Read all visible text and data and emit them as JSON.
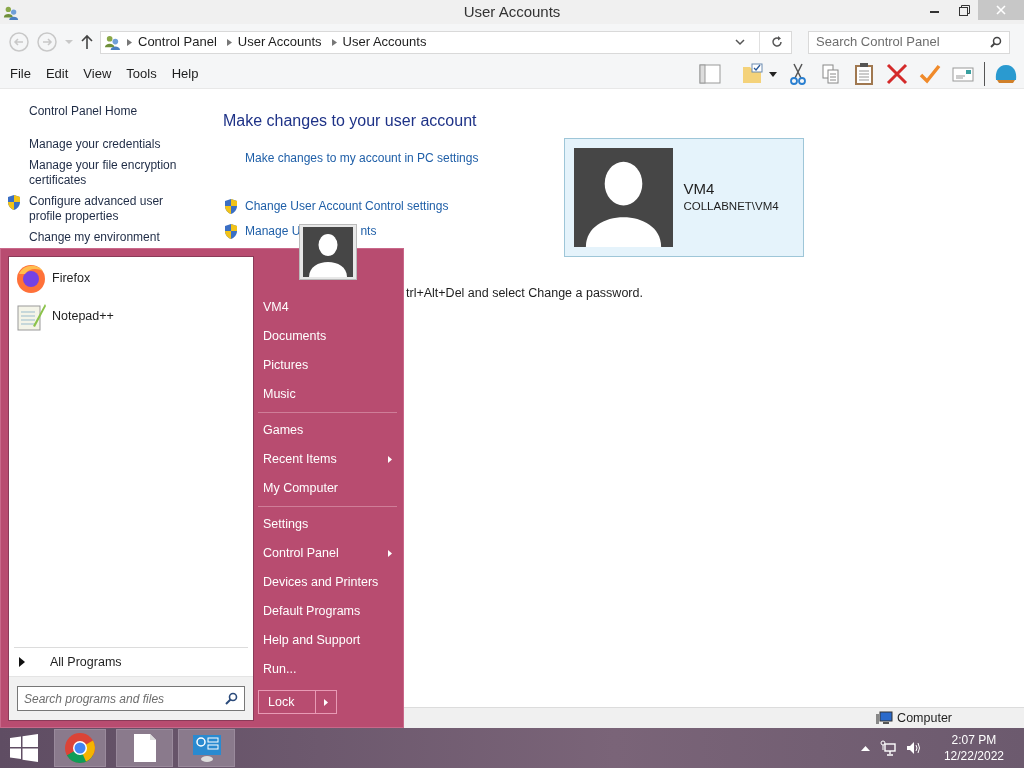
{
  "window": {
    "title": "User Accounts"
  },
  "address": {
    "breadcrumbs": [
      "Control Panel",
      "User Accounts",
      "User Accounts"
    ]
  },
  "search": {
    "placeholder": "Search Control Panel"
  },
  "menu": [
    "File",
    "Edit",
    "View",
    "Tools",
    "Help"
  ],
  "sidebar": {
    "items": [
      {
        "text": "Control Panel Home",
        "shield": false
      },
      {
        "text": "Manage your credentials",
        "shield": false
      },
      {
        "text": "Manage your file encryption certificates",
        "shield": false
      },
      {
        "text": "Configure advanced user profile properties",
        "shield": true
      },
      {
        "text": "Change my environment",
        "shield": false
      }
    ]
  },
  "main": {
    "heading": "Make changes to your user account",
    "links": [
      {
        "text": "Make changes to my account in PC settings",
        "shield": false
      },
      {
        "text": "Change User Account Control settings",
        "shield": true
      },
      {
        "text": "Manage U",
        "tail": "nts",
        "shield": true
      }
    ],
    "account": {
      "name": "VM4",
      "domain": "COLLABNET\\VM4"
    },
    "note": "trl+Alt+Del and select Change a password."
  },
  "start_menu": {
    "pinned": [
      {
        "name": "Firefox",
        "kind": "firefox"
      },
      {
        "name": "Notepad++",
        "kind": "notepad"
      }
    ],
    "all_programs": "All Programs",
    "search_placeholder": "Search programs and files",
    "groups": [
      [
        {
          "text": "VM4",
          "submenu": false
        },
        {
          "text": "Documents",
          "submenu": false
        },
        {
          "text": "Pictures",
          "submenu": false
        },
        {
          "text": "Music",
          "submenu": false
        }
      ],
      [
        {
          "text": "Games",
          "submenu": false
        },
        {
          "text": "Recent Items",
          "submenu": true
        },
        {
          "text": "My Computer",
          "submenu": false
        }
      ],
      [
        {
          "text": "Settings",
          "submenu": false
        },
        {
          "text": "Control Panel",
          "submenu": true
        },
        {
          "text": "Devices and Printers",
          "submenu": false
        },
        {
          "text": "Default Programs",
          "submenu": false
        },
        {
          "text": "Help and Support",
          "submenu": false
        },
        {
          "text": "Run...",
          "submenu": false
        }
      ]
    ],
    "power": "Lock"
  },
  "status_bar": {
    "location": "Computer"
  },
  "taskbar": {
    "time": "2:07 PM",
    "date": "12/22/2022"
  }
}
